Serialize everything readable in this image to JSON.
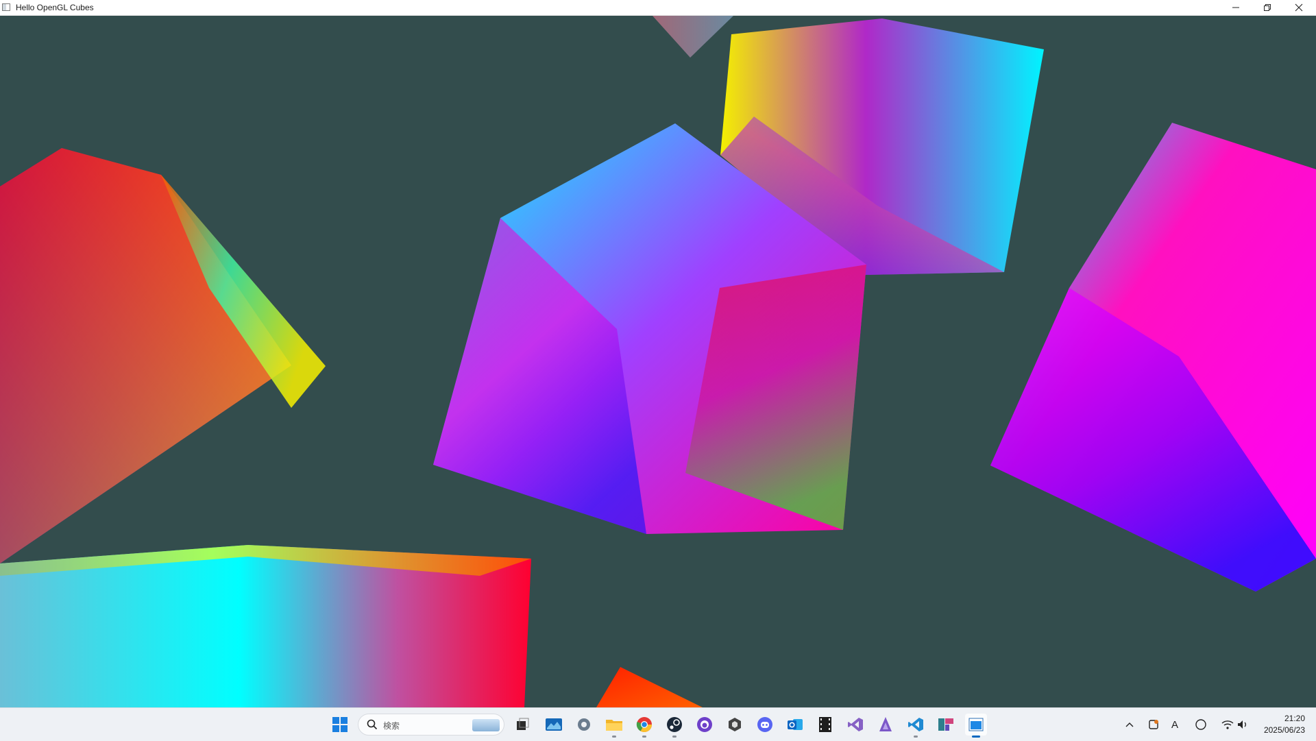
{
  "window": {
    "title": "Hello OpenGL Cubes"
  },
  "colors": {
    "clear_color": "#334d4d",
    "taskbar": "#eef1f5",
    "accent": "#0067c0"
  },
  "taskbar": {
    "search_placeholder": "検索",
    "pinned": [
      "windows-start-icon",
      "task-view-icon",
      "widgets-icon",
      "settings-icon",
      "file-explorer-icon",
      "chrome-icon",
      "steam-icon",
      "github-desktop-icon",
      "unity-hub-icon",
      "discord-icon",
      "outlook-icon",
      "film-editor-icon",
      "visual-studio-icon",
      "shader-app-icon",
      "vscode-icon",
      "project-tool-icon",
      "opengl-app-icon"
    ],
    "tray": [
      "chevron-up-icon",
      "sync-icon",
      "ime-icon",
      "focus-icon",
      "wifi-icon",
      "volume-icon"
    ],
    "ime_label": "A",
    "time": "21:20",
    "date": "2025/06/23"
  }
}
